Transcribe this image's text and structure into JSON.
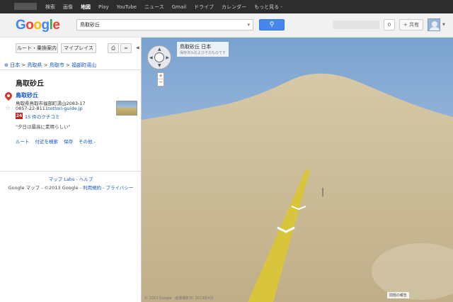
{
  "gbar": {
    "links": [
      "検索",
      "画像",
      "地図",
      "Play",
      "YouTube",
      "ニュース",
      "Gmail",
      "ドライブ",
      "カレンダー",
      "もっと見る -"
    ]
  },
  "header": {
    "logo": "Google",
    "search_value": "鳥取砂丘",
    "count": "0",
    "share": "+ 共有"
  },
  "toolbar": {
    "route": "ルート・乗換案内",
    "my_places": "マイプレイス"
  },
  "breadcrumb": {
    "prefix": "⊕ ",
    "items": [
      "日本",
      "鳥取県",
      "鳥取市",
      "福部町湯山"
    ],
    "sep": " > "
  },
  "place": {
    "title": "鳥取砂丘",
    "name": "鳥取砂丘",
    "address": "鳥取県鳥取市福部町湯山2083-17",
    "phone": "0857-22-8111",
    "url": "tottori-guide.jp",
    "review_count": "24",
    "review_text": "15 件のクチコミ",
    "quote": "\"夕日は最高に素晴らしい\"",
    "actions": [
      "ルート",
      "付近を検索",
      "保存",
      "その他 -"
    ]
  },
  "footer": {
    "labs": "マップ Labs",
    "help": "ヘルプ",
    "sep": " - ",
    "copyright": "Google マップ - ©2013 Google - ",
    "terms": "利用規約",
    "privacy": "プライバシー"
  },
  "streetview": {
    "label_title": "鳥取砂丘 日本",
    "label_sub": "保存済みおよびそのものです",
    "copyright": "© 2013 Google · 画像撮影日: 2013年4月",
    "report": "問題の報告"
  },
  "colors": {
    "sky_top": "#7aa2cf",
    "sky_bottom": "#c2d5ea",
    "sand": "#c9b891",
    "road_line": "#d9c53b",
    "link": "#1155cc",
    "search_btn": "#4787ed"
  }
}
